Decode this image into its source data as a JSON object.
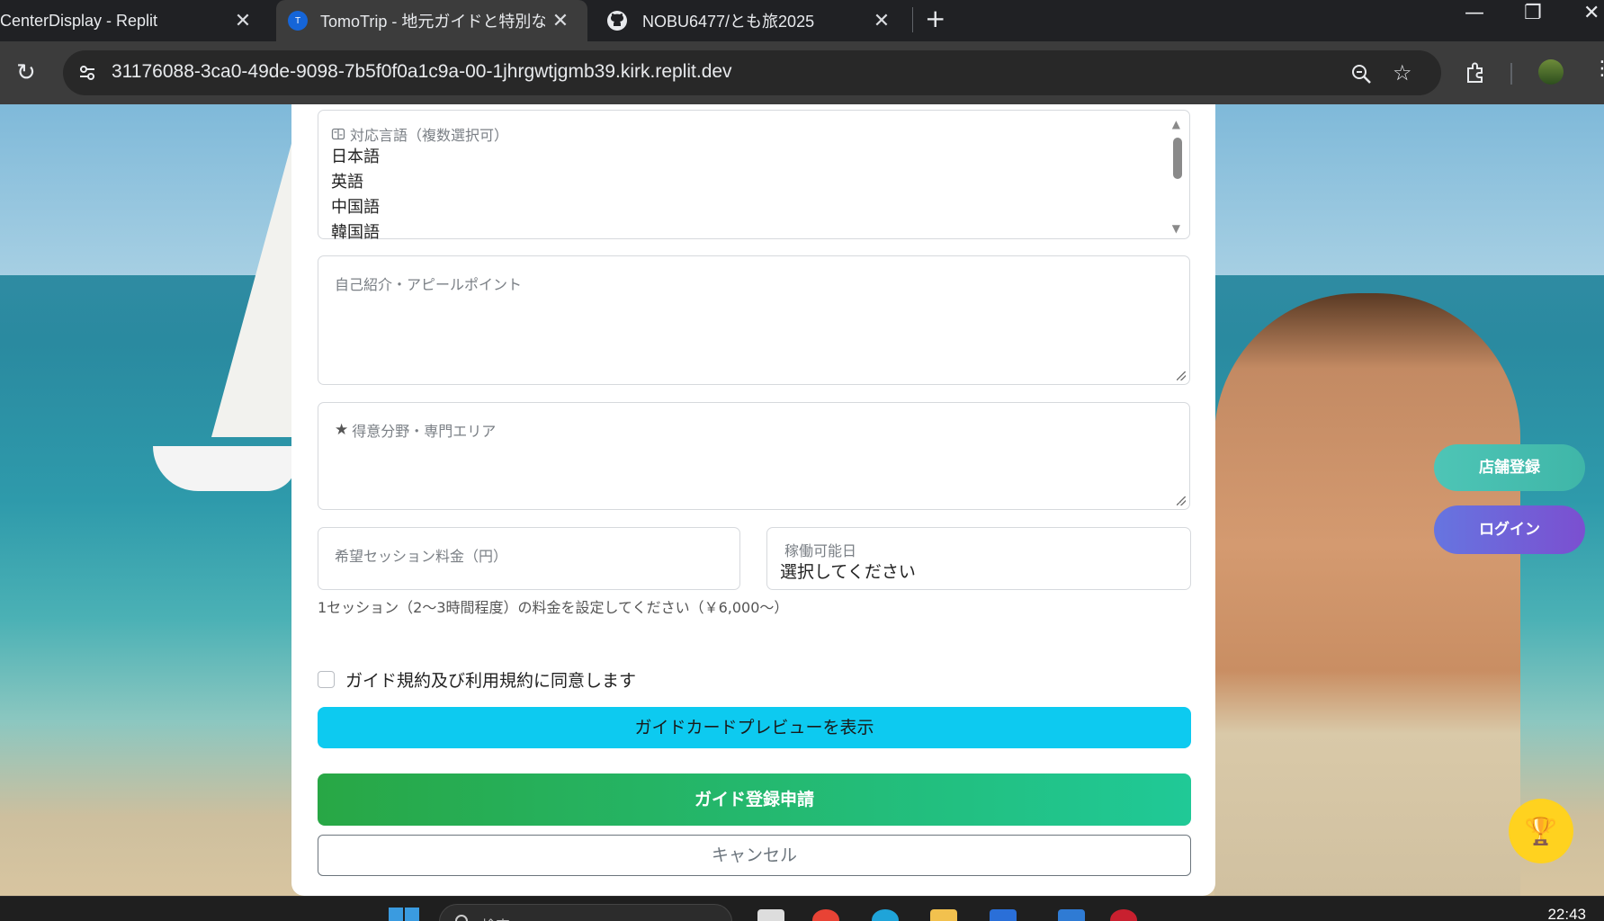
{
  "browser": {
    "tabs": [
      {
        "title": "CenterDisplay - Replit"
      },
      {
        "title": "TomoTrip - 地元ガイドと特別な旅",
        "favicon_letter": "T"
      },
      {
        "title": "NOBU6477/とも旅2025"
      }
    ],
    "url": "31176088-3ca0-49de-9098-7b5f0f0a1c9a-00-1jhrgwtjgmb39.kirk.replit.dev"
  },
  "form": {
    "languages": {
      "label": "対応言語（複数選択可）",
      "options": [
        "日本語",
        "英語",
        "中国語",
        "韓国語"
      ]
    },
    "intro_placeholder": "自己紹介・アピールポイント",
    "specialty_label": "得意分野・専門エリア",
    "fee_label": "希望セッション料金（円）",
    "availability": {
      "label": "稼働可能日",
      "value": "選択してください"
    },
    "fee_hint": "1セッション（2〜3時間程度）の料金を設定してください（￥6,000〜）",
    "agree_label": "ガイド規約及び利用規約に同意します",
    "preview_button": "ガイドカードプレビューを表示",
    "submit_button": "ガイド登録申請",
    "cancel_button": "キャンセル"
  },
  "side_buttons": {
    "store_register": "店舗登録",
    "login": "ログイン"
  },
  "taskbar": {
    "search_placeholder": "検索",
    "clock": "22:43"
  },
  "colors": {
    "preview": "#0dcaf0",
    "submit_start": "#28a745",
    "submit_end": "#20c997",
    "store": "#4ec5b6",
    "login": "#6675e0",
    "trophy": "#ffd21f"
  }
}
